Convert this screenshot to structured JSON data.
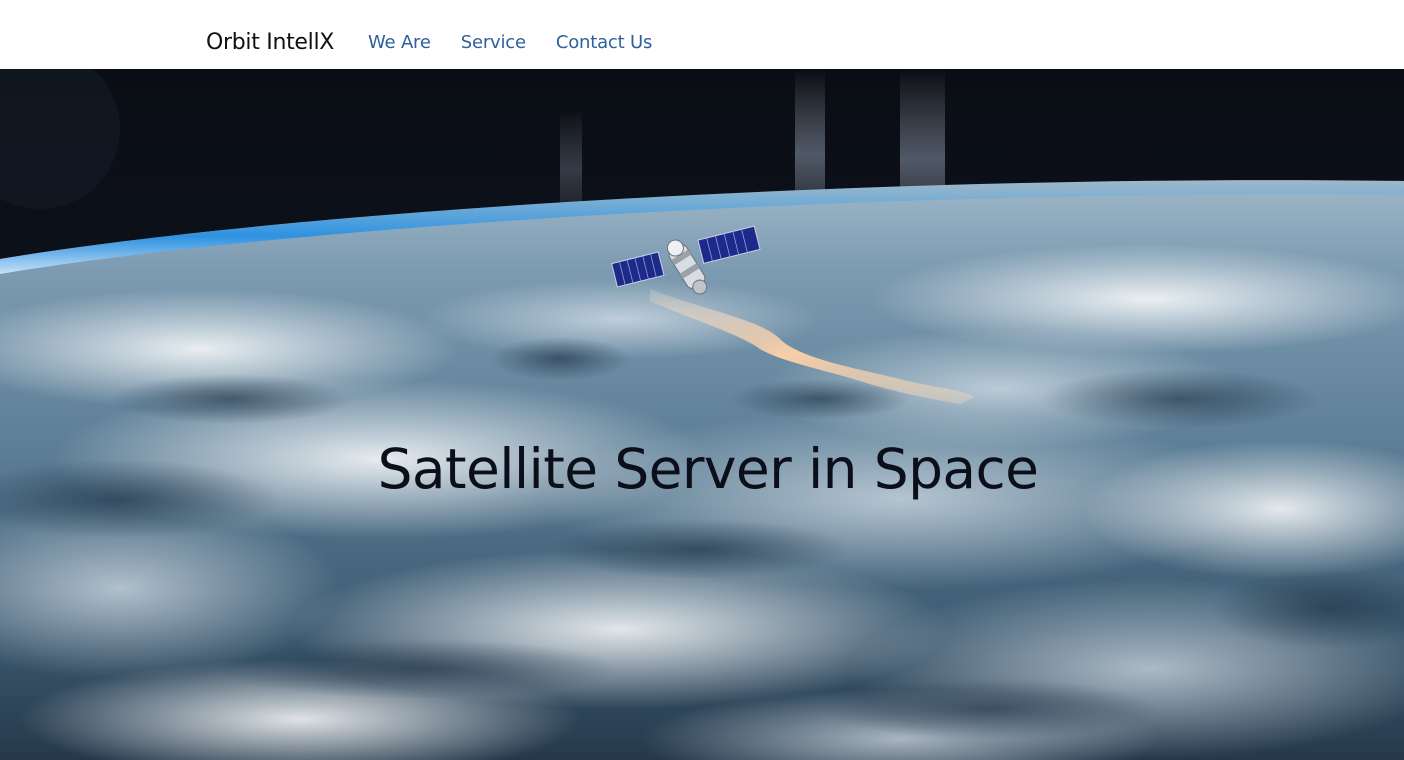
{
  "navbar": {
    "brand": "Orbit IntellX",
    "links": [
      {
        "label": "We Are"
      },
      {
        "label": "Service"
      },
      {
        "label": "Contact Us"
      }
    ]
  },
  "hero": {
    "title": "Satellite Server in Space",
    "background": "earth-from-orbit-image",
    "foreground_image": "satellite-image"
  },
  "colors": {
    "nav_link": "#2f5f9e",
    "brand": "#111111",
    "hero_title": "#0b0f1a",
    "space": "#05080f",
    "atmosphere": "#1e8ee8"
  }
}
